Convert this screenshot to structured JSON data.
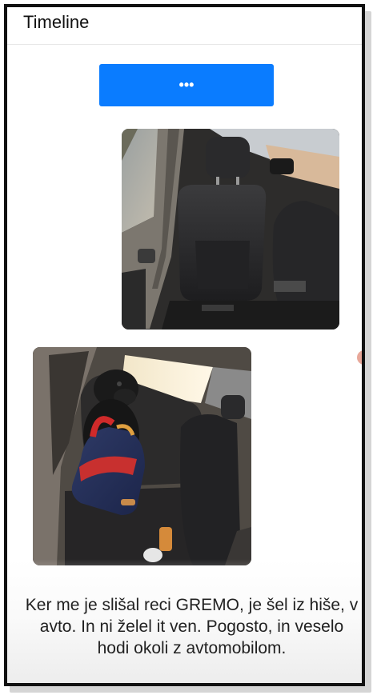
{
  "header": {
    "title": "Timeline"
  },
  "load_more": {
    "label": "•••"
  },
  "posts": [
    {
      "icon": "car-interior-photo"
    },
    {
      "icon": "dog-in-car-photo"
    }
  ],
  "caption": {
    "text": "Ker me je slišal reci GREMO, je šel iz hiše, v avto. In ni želel it ven. Pogosto, in veselo hodi okoli z avtomobilom."
  },
  "colors": {
    "accent": "#0a7cff",
    "frame": "#111111"
  }
}
